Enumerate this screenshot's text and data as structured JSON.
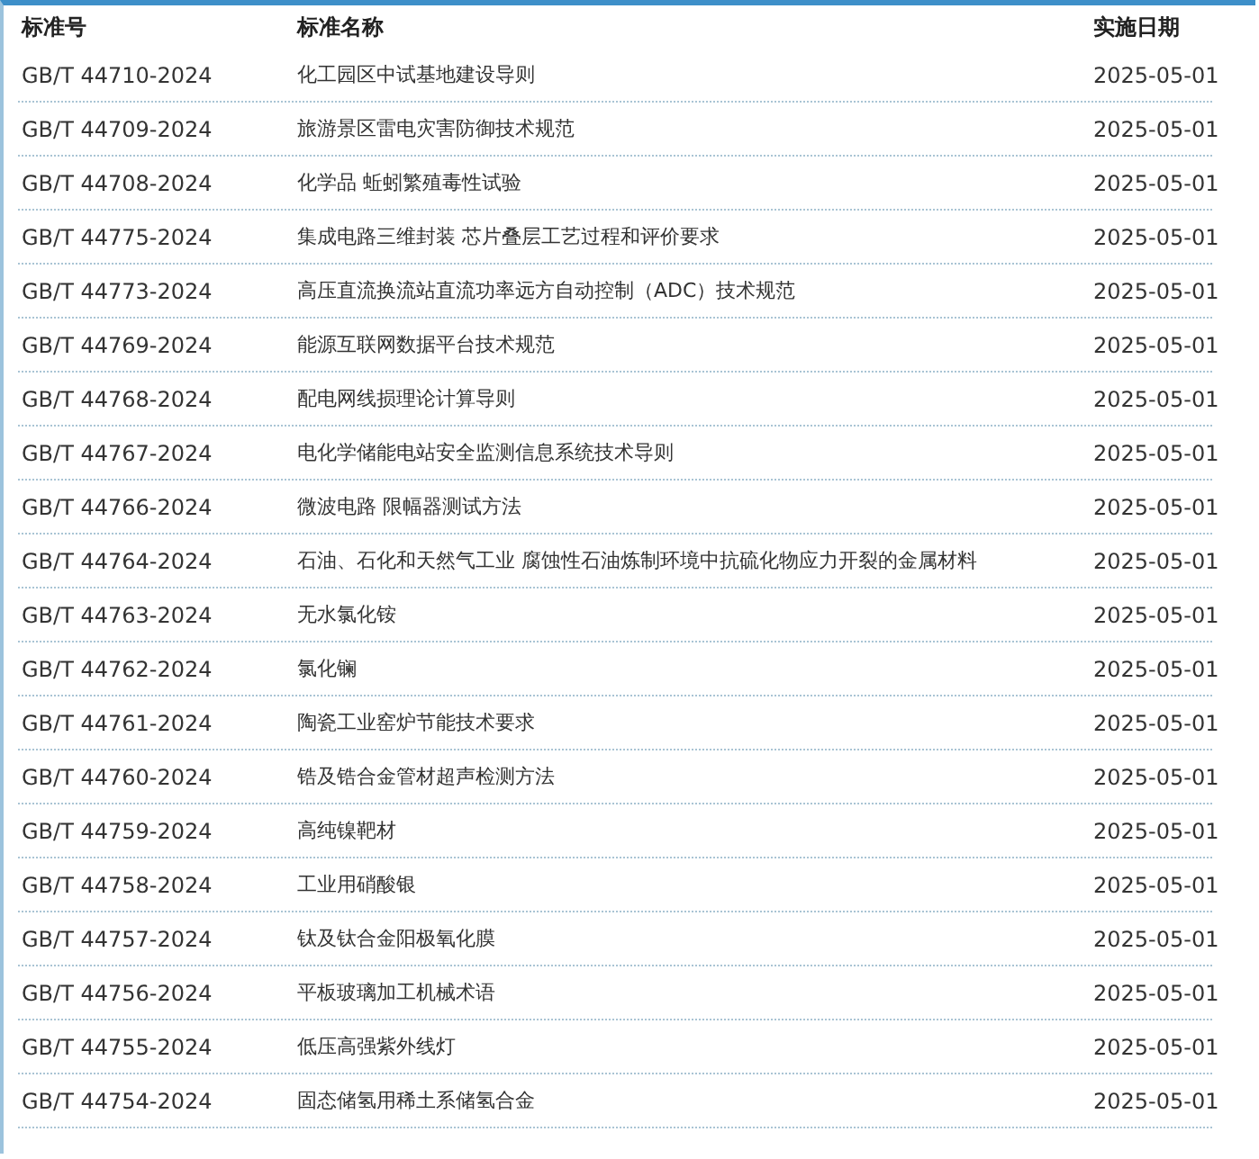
{
  "table": {
    "columns": [
      "标准号",
      "标准名称",
      "实施日期"
    ],
    "rows": [
      {
        "number": "GB/T 44710-2024",
        "name": "化工园区中试基地建设导则",
        "date": "2025-05-01"
      },
      {
        "number": "GB/T 44709-2024",
        "name": "旅游景区雷电灾害防御技术规范",
        "date": "2025-05-01"
      },
      {
        "number": "GB/T 44708-2024",
        "name": "化学品 蚯蚓繁殖毒性试验",
        "date": "2025-05-01"
      },
      {
        "number": "GB/T 44775-2024",
        "name": "集成电路三维封装 芯片叠层工艺过程和评价要求",
        "date": "2025-05-01"
      },
      {
        "number": "GB/T 44773-2024",
        "name": "高压直流换流站直流功率远方自动控制（ADC）技术规范",
        "date": "2025-05-01"
      },
      {
        "number": "GB/T 44769-2024",
        "name": "能源互联网数据平台技术规范",
        "date": "2025-05-01"
      },
      {
        "number": "GB/T 44768-2024",
        "name": "配电网线损理论计算导则",
        "date": "2025-05-01"
      },
      {
        "number": "GB/T 44767-2024",
        "name": "电化学储能电站安全监测信息系统技术导则",
        "date": "2025-05-01"
      },
      {
        "number": "GB/T 44766-2024",
        "name": "微波电路 限幅器测试方法",
        "date": "2025-05-01"
      },
      {
        "number": "GB/T 44764-2024",
        "name": "石油、石化和天然气工业 腐蚀性石油炼制环境中抗硫化物应力开裂的金属材料",
        "date": "2025-05-01"
      },
      {
        "number": "GB/T 44763-2024",
        "name": "无水氯化铵",
        "date": "2025-05-01"
      },
      {
        "number": "GB/T 44762-2024",
        "name": "氯化镧",
        "date": "2025-05-01"
      },
      {
        "number": "GB/T 44761-2024",
        "name": "陶瓷工业窑炉节能技术要求",
        "date": "2025-05-01"
      },
      {
        "number": "GB/T 44760-2024",
        "name": "锆及锆合金管材超声检测方法",
        "date": "2025-05-01"
      },
      {
        "number": "GB/T 44759-2024",
        "name": "高纯镍靶材",
        "date": "2025-05-01"
      },
      {
        "number": "GB/T 44758-2024",
        "name": "工业用硝酸银",
        "date": "2025-05-01"
      },
      {
        "number": "GB/T 44757-2024",
        "name": "钛及钛合金阳极氧化膜",
        "date": "2025-05-01"
      },
      {
        "number": "GB/T 44756-2024",
        "name": "平板玻璃加工机械术语",
        "date": "2025-05-01"
      },
      {
        "number": "GB/T 44755-2024",
        "name": "低压高强紫外线灯",
        "date": "2025-05-01"
      },
      {
        "number": "GB/T 44754-2024",
        "name": "固态储氢用稀土系储氢合金",
        "date": "2025-05-01"
      }
    ]
  }
}
